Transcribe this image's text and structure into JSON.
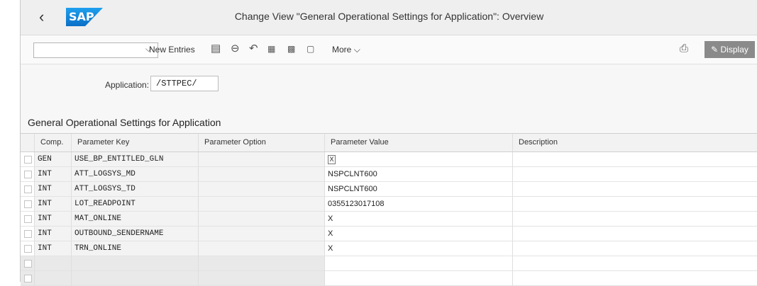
{
  "shell": {
    "back_glyph": "‹",
    "logo_text": "SAP",
    "title": "Change View \"General Operational Settings for Application\": Overview"
  },
  "toolbar": {
    "dropdown_value": "",
    "new_entries_label": "New Entries",
    "more_label": "More",
    "display_label": "Display",
    "icons": [
      "copy-icon",
      "delete-icon",
      "undo-icon",
      "select-all-icon",
      "select-block-icon",
      "deselect-all-icon",
      "print-icon"
    ]
  },
  "application": {
    "label": "Application:",
    "value": "/STTPEC/"
  },
  "section_title": "General Operational Settings for Application",
  "table": {
    "columns": [
      "Comp.",
      "Parameter Key",
      "Parameter Option",
      "Parameter Value",
      "Description"
    ],
    "rows": [
      {
        "comp": "GEN",
        "key": "USE_BP_ENTITLED_GLN",
        "option": "",
        "value": "X",
        "description": ""
      },
      {
        "comp": "INT",
        "key": "ATT_LOGSYS_MD",
        "option": "",
        "value": "NSPCLNT600",
        "description": ""
      },
      {
        "comp": "INT",
        "key": "ATT_LOGSYS_TD",
        "option": "",
        "value": "NSPCLNT600",
        "description": ""
      },
      {
        "comp": "INT",
        "key": "LOT_READPOINT",
        "option": "",
        "value": "0355123017108",
        "description": ""
      },
      {
        "comp": "INT",
        "key": "MAT_ONLINE",
        "option": "",
        "value": "X",
        "description": ""
      },
      {
        "comp": "INT",
        "key": "OUTBOUND_SENDERNAME",
        "option": "",
        "value": "X",
        "description": ""
      },
      {
        "comp": "INT",
        "key": "TRN_ONLINE",
        "option": "",
        "value": "X",
        "description": ""
      }
    ]
  }
}
